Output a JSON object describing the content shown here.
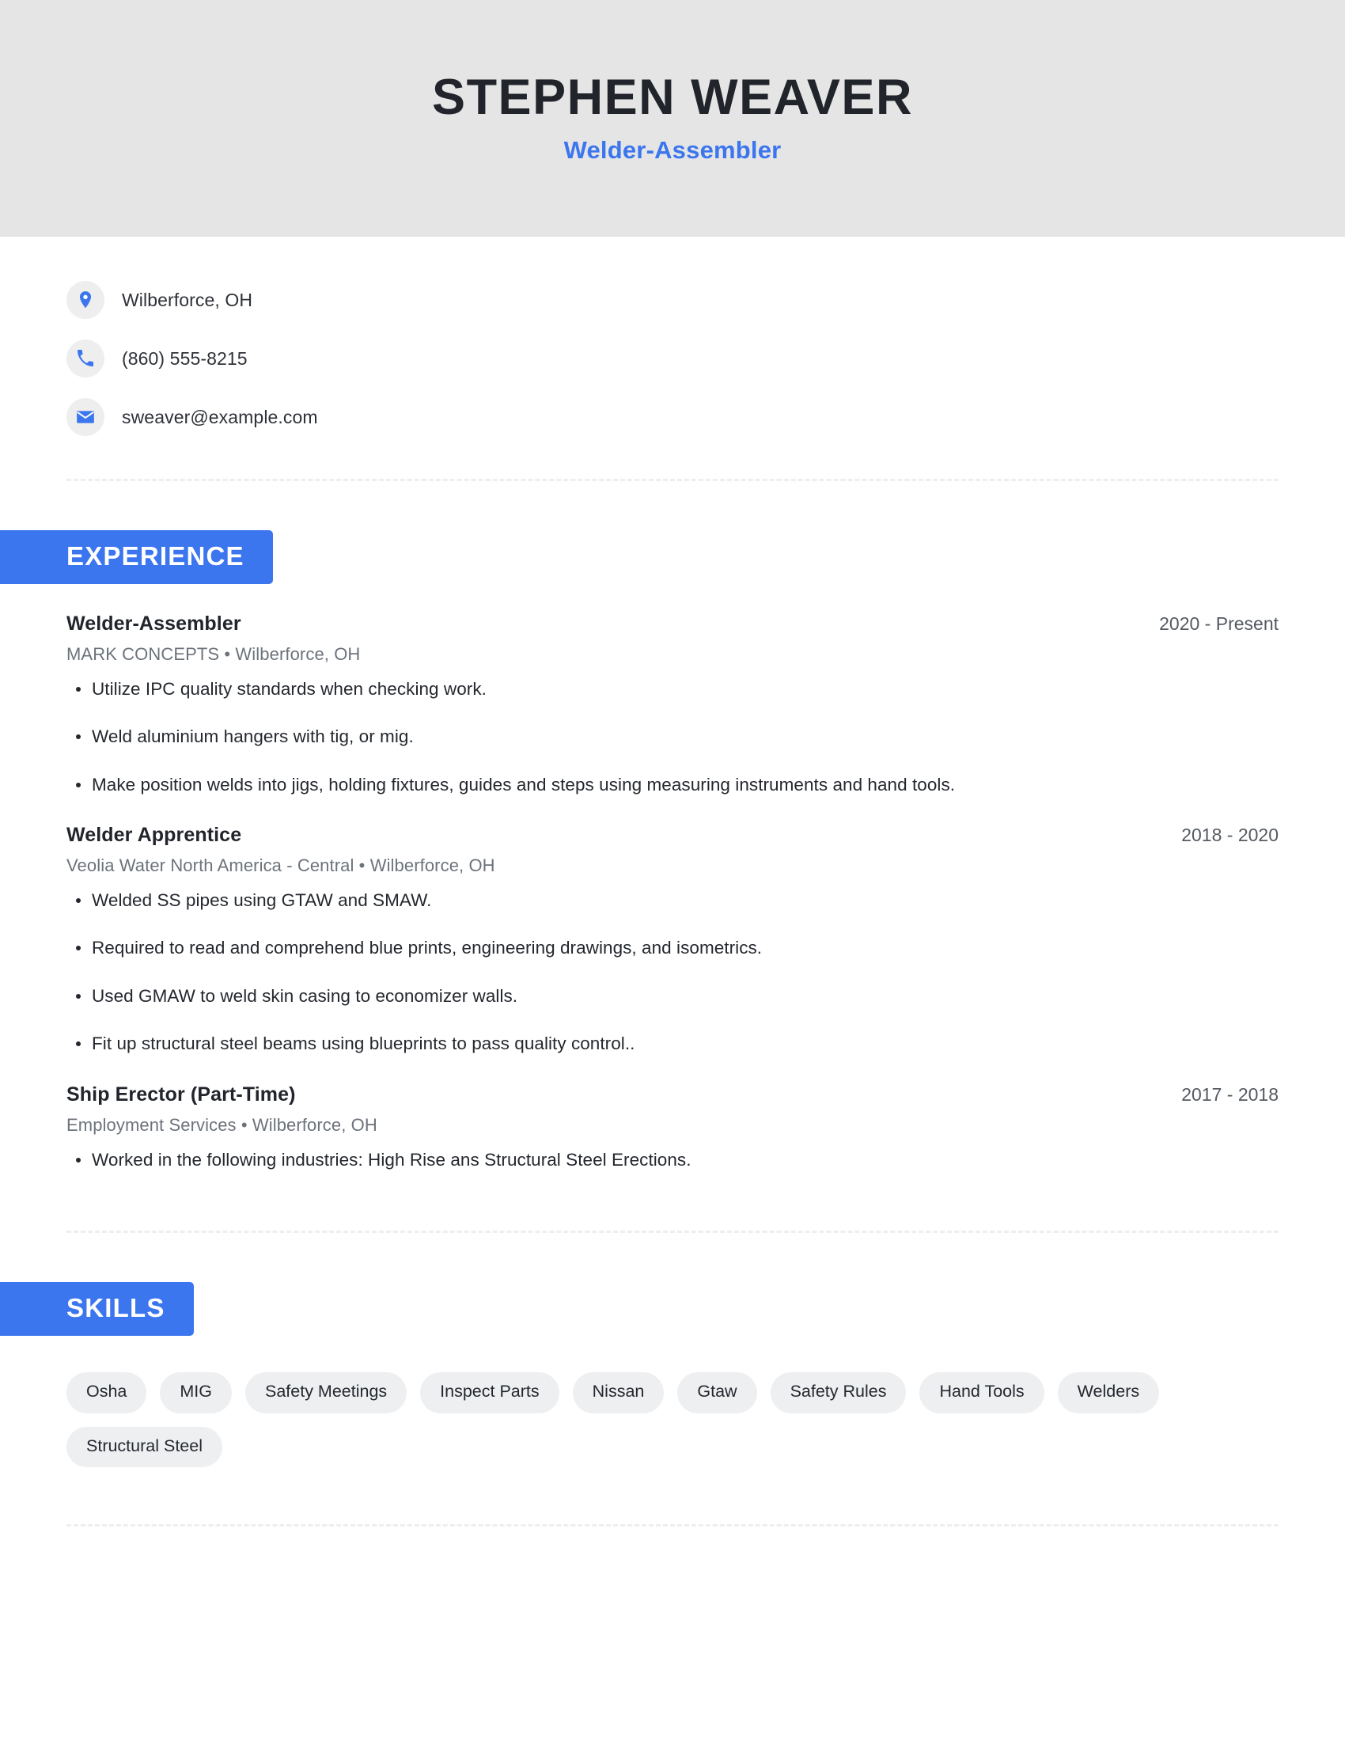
{
  "colors": {
    "accent": "#3b76ef",
    "header_band": "#e5e5e5",
    "chip_bg": "#eeeff1",
    "icon_bg": "#eeeeee",
    "text_dark": "#21242b",
    "text_muted": "#6d737b",
    "divider": "#eceef0"
  },
  "header": {
    "name": "STEPHEN WEAVER",
    "title": "Welder-Assembler"
  },
  "contact": {
    "items": [
      {
        "icon": "location-pin-icon",
        "text": "Wilberforce, OH"
      },
      {
        "icon": "phone-icon",
        "text": "(860) 555-8215"
      },
      {
        "icon": "envelope-icon",
        "text": "sweaver@example.com"
      }
    ]
  },
  "experience": {
    "heading": "EXPERIENCE",
    "jobs": [
      {
        "role": "Welder-Assembler",
        "dates": "2020 - Present",
        "meta": "MARK CONCEPTS  •  Wilberforce, OH",
        "bullets": [
          "Utilize IPC quality standards when checking work.",
          "Weld aluminium hangers with tig, or mig.",
          "Make position welds into jigs, holding fixtures, guides and steps using measuring instruments and hand tools."
        ]
      },
      {
        "role": "Welder Apprentice",
        "dates": "2018 - 2020",
        "meta": "Veolia Water North America - Central  •  Wilberforce, OH",
        "bullets": [
          "Welded SS pipes using GTAW and SMAW.",
          "Required to read and comprehend blue prints, engineering drawings, and isometrics.",
          "Used GMAW to weld skin casing to economizer walls.",
          "Fit up structural steel beams using blueprints to pass quality control.."
        ]
      },
      {
        "role": "Ship Erector (Part-Time)",
        "dates": "2017 - 2018",
        "meta": "Employment Services  •  Wilberforce, OH",
        "bullets": [
          "Worked in the following industries: High Rise ans Structural Steel Erections."
        ]
      }
    ]
  },
  "skills": {
    "heading": "SKILLS",
    "items": [
      "Osha",
      "MIG",
      "Safety Meetings",
      "Inspect Parts",
      "Nissan",
      "Gtaw",
      "Safety Rules",
      "Hand Tools",
      "Welders",
      "Structural Steel"
    ]
  }
}
